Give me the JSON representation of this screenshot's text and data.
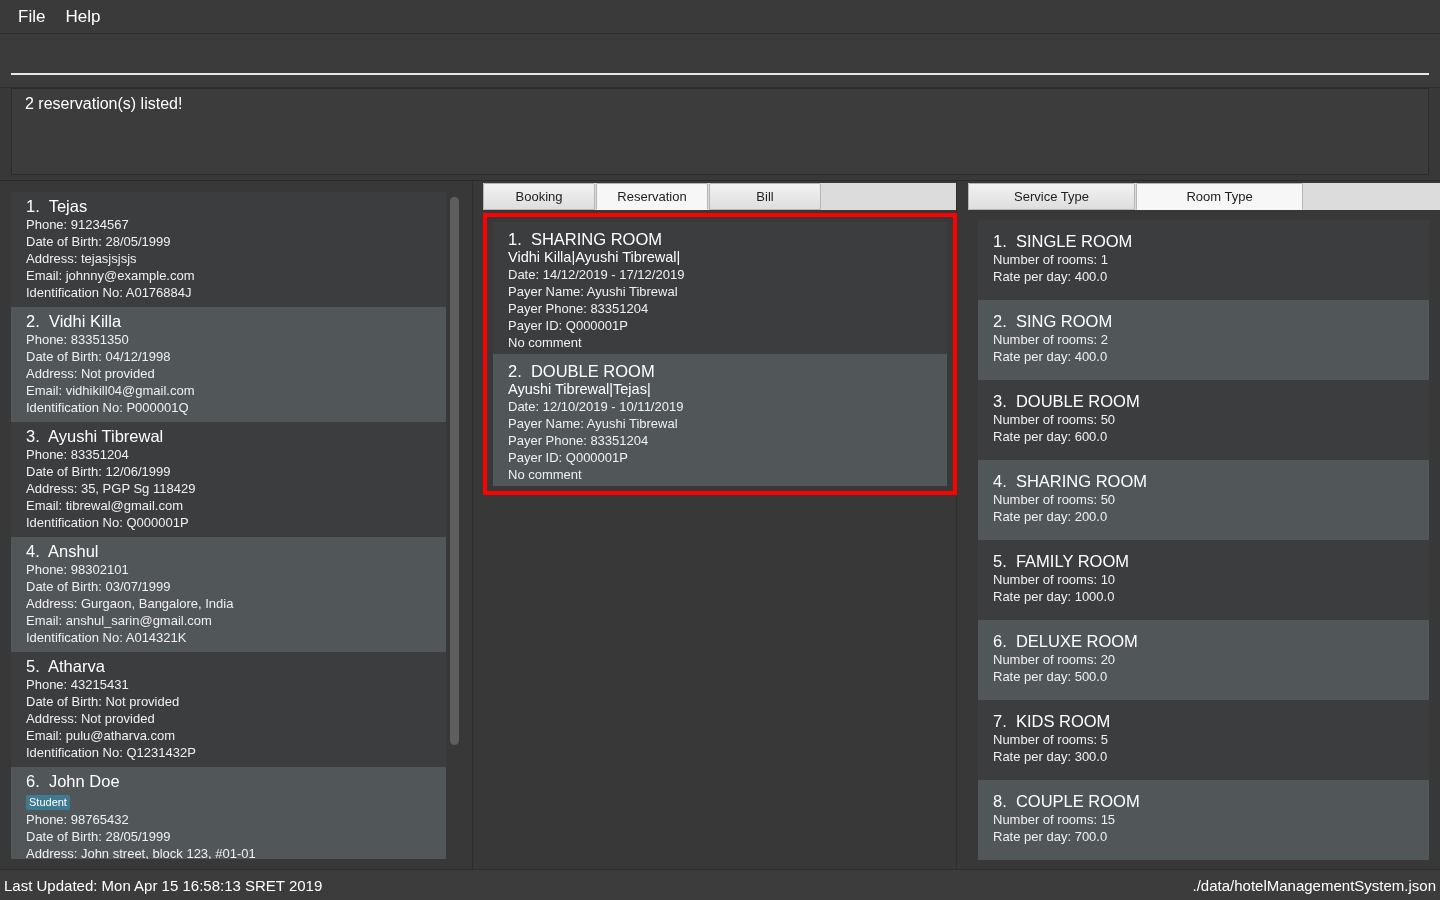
{
  "menu": [
    "File",
    "Help"
  ],
  "result_display": "2 reservation(s) listed!",
  "guests": [
    {
      "index": "1.",
      "name": "Tejas",
      "lines": [
        "Phone: 91234567",
        "Date of Birth: 28/05/1999",
        "Address: tejasjsjsjs",
        "Email: johnny@example.com",
        "Identification No: A0176884J"
      ]
    },
    {
      "index": "2.",
      "name": "Vidhi Killa",
      "lines": [
        "Phone: 83351350",
        "Date of Birth: 04/12/1998",
        "Address: Not provided",
        "Email: vidhikill04@gmail.com",
        "Identification No: P000001Q"
      ]
    },
    {
      "index": "3.",
      "name": "Ayushi Tibrewal",
      "lines": [
        "Phone: 83351204",
        "Date of Birth: 12/06/1999",
        "Address: 35, PGP Sg 118429",
        "Email: tibrewal@gmail.com",
        "Identification No: Q000001P"
      ]
    },
    {
      "index": "4.",
      "name": "Anshul",
      "lines": [
        "Phone: 98302101",
        "Date of Birth: 03/07/1999",
        "Address: Gurgaon, Bangalore, India",
        "Email: anshul_sarin@gmail.com",
        "Identification No: A014321K"
      ]
    },
    {
      "index": "5.",
      "name": "Atharva",
      "lines": [
        "Phone: 43215431",
        "Date of Birth: Not provided",
        "Address: Not provided",
        "Email: pulu@atharva.com",
        "Identification No: Q1231432P"
      ]
    },
    {
      "index": "6.",
      "name": "John Doe",
      "tags": [
        "Student"
      ],
      "lines": [
        "Phone: 98765432",
        "Date of Birth: 28/05/1999",
        "Address: John street, block 123, #01-01"
      ]
    }
  ],
  "middle_tabs": [
    {
      "label": "Booking",
      "selected": false
    },
    {
      "label": "Reservation",
      "selected": true
    },
    {
      "label": "Bill",
      "selected": false
    }
  ],
  "reservations": {
    "focused": true,
    "items": [
      {
        "index": "1.",
        "title": "SHARING ROOM",
        "guests": "Vidhi Killa|Ayushi Tibrewal|",
        "lines": [
          "Date: 14/12/2019 - 17/12/2019",
          "Payer Name: Ayushi Tibrewal",
          "Payer Phone: 83351204",
          "Payer ID: Q000001P",
          "No comment"
        ]
      },
      {
        "index": "2.",
        "title": "DOUBLE ROOM",
        "guests": "Ayushi Tibrewal|Tejas|",
        "lines": [
          "Date: 12/10/2019 - 10/11/2019",
          "Payer Name: Ayushi Tibrewal",
          "Payer Phone: 83351204",
          "Payer ID: Q000001P",
          "No comment"
        ]
      }
    ]
  },
  "right_tabs": [
    {
      "label": "Service Type",
      "selected": false
    },
    {
      "label": "Room Type",
      "selected": true
    }
  ],
  "rooms": [
    {
      "index": "1.",
      "name": "SINGLE ROOM",
      "lines": [
        "Number of rooms: 1",
        "Rate per day: 400.0"
      ]
    },
    {
      "index": "2.",
      "name": "SING ROOM",
      "lines": [
        "Number of rooms: 2",
        "Rate per day: 400.0"
      ]
    },
    {
      "index": "3.",
      "name": "DOUBLE ROOM",
      "lines": [
        "Number of rooms: 50",
        "Rate per day: 600.0"
      ]
    },
    {
      "index": "4.",
      "name": "SHARING ROOM",
      "lines": [
        "Number of rooms: 50",
        "Rate per day: 200.0"
      ]
    },
    {
      "index": "5.",
      "name": "FAMILY ROOM",
      "lines": [
        "Number of rooms: 10",
        "Rate per day: 1000.0"
      ]
    },
    {
      "index": "6.",
      "name": "DELUXE ROOM",
      "lines": [
        "Number of rooms: 20",
        "Rate per day: 500.0"
      ]
    },
    {
      "index": "7.",
      "name": "KIDS ROOM",
      "lines": [
        "Number of rooms: 5",
        "Rate per day: 300.0"
      ]
    },
    {
      "index": "8.",
      "name": "COUPLE ROOM",
      "lines": [
        "Number of rooms: 15",
        "Rate per day: 700.0"
      ]
    }
  ],
  "status_bar": {
    "last_updated": "Last Updated: Mon Apr 15 16:58:13 SRET 2019",
    "file_path": "./data/hotelManagementSystem.json"
  }
}
